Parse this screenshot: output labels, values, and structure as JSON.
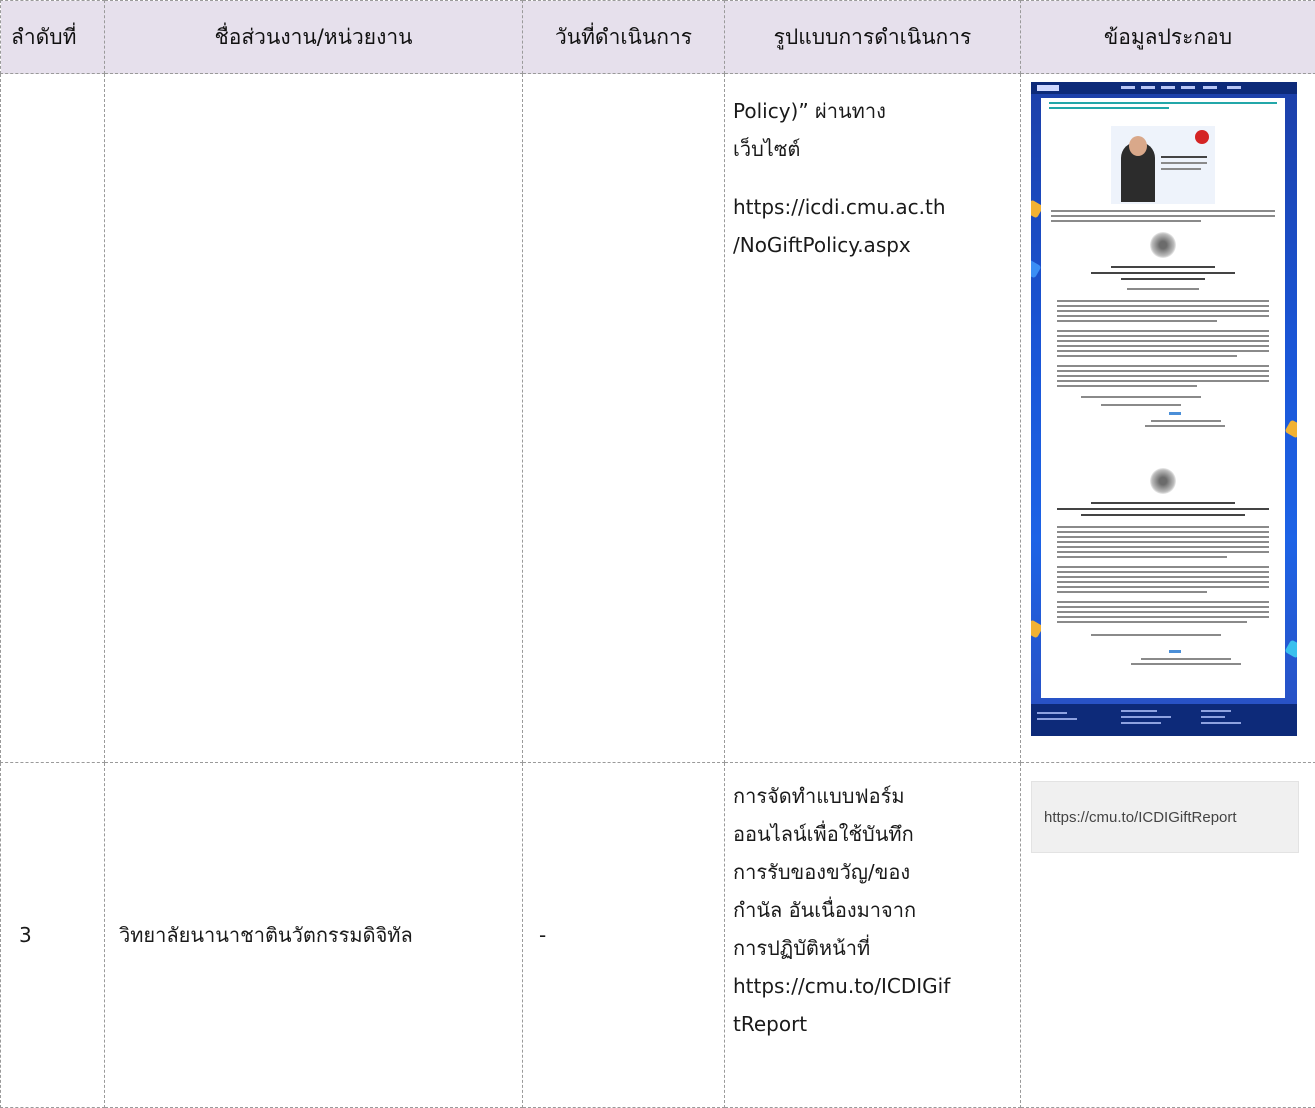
{
  "header": {
    "col_no": "ลำดับที่",
    "col_unit": "ชื่อส่วนงาน/หน่วยงาน",
    "col_date": "วันที่ดำเนินการ",
    "col_format": "รูปแบบการดำเนินการ",
    "col_info": "ข้อมูลประกอบ"
  },
  "row_continued": {
    "format_line1": "Policy)” ผ่านทาง",
    "format_line2": "เว็บไซต์",
    "url_line1": "https://icdi.cmu.ac.th",
    "url_line2": "/NoGiftPolicy.aspx",
    "thumbnail_icon": "website-screenshot"
  },
  "row3": {
    "number": "3",
    "unit": "วิทยาลัยนานาชาตินวัตกรรมดิจิทัล",
    "date": "-",
    "format_lines": [
      "การจัดทำแบบฟอร์ม",
      "ออนไลน์เพื่อใช้บันทึก",
      "การรับของขวัญ/ของ",
      "กำนัล อันเนื่องมาจาก",
      "การปฏิบัติหน้าที่",
      "https://cmu.to/ICDIGif",
      "tReport"
    ],
    "info_link": "https://cmu.to/ICDIGiftReport"
  },
  "colors": {
    "header_bg": "#e6e0ec",
    "border": "#9a9a9a",
    "thumbnail_blue": "#1a55d6"
  }
}
